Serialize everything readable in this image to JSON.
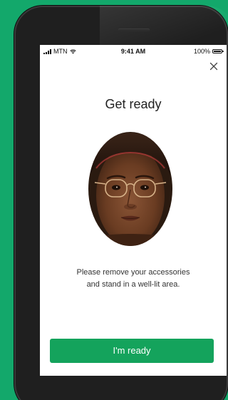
{
  "colors": {
    "page_background": "#13a86b",
    "primary_button": "#14a35c",
    "screen_background": "#ffffff"
  },
  "status_bar": {
    "carrier": "MTN",
    "time": "9:41 AM",
    "battery": "100%",
    "icons": [
      "signal-icon",
      "wifi-icon",
      "battery-icon"
    ]
  },
  "header": {
    "close_icon": "close-icon"
  },
  "main": {
    "title": "Get ready",
    "instruction_line1": "Please remove your accessories",
    "instruction_line2": "and stand in a well-lit area."
  },
  "actions": {
    "ready_label": "I'm ready"
  }
}
